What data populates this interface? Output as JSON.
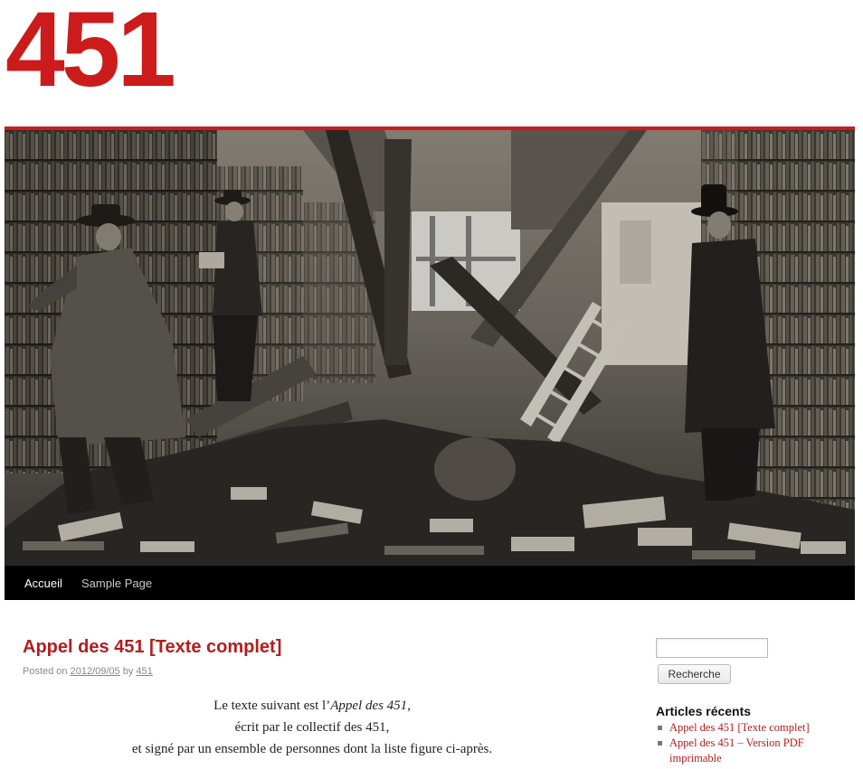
{
  "site": {
    "title": "451"
  },
  "nav": {
    "items": [
      {
        "label": "Accueil",
        "active": true
      },
      {
        "label": "Sample Page",
        "active": false
      }
    ]
  },
  "post": {
    "title": "Appel des 451 [Texte complet]",
    "meta": {
      "posted_on_label": "Posted on",
      "date": "2012/09/05",
      "by_label": "by",
      "author": "451"
    },
    "body": {
      "line1_prefix": "Le texte suivant est l’",
      "line1_emphasis": "Appel des 451",
      "line1_suffix": ",",
      "line2": "écrit par le collectif des 451,",
      "line3": "et signé par un ensemble de personnes dont la liste figure ci-après."
    }
  },
  "sidebar": {
    "search": {
      "value": "",
      "button_label": "Recherche"
    },
    "recent": {
      "title": "Articles récents",
      "items": [
        "Appel des 451 [Texte complet]",
        "Appel des 451 – Version PDF imprimable"
      ]
    }
  },
  "colors": {
    "accent": "#cc1b1b",
    "link": "#b51c1c",
    "navbar": "#000000"
  }
}
